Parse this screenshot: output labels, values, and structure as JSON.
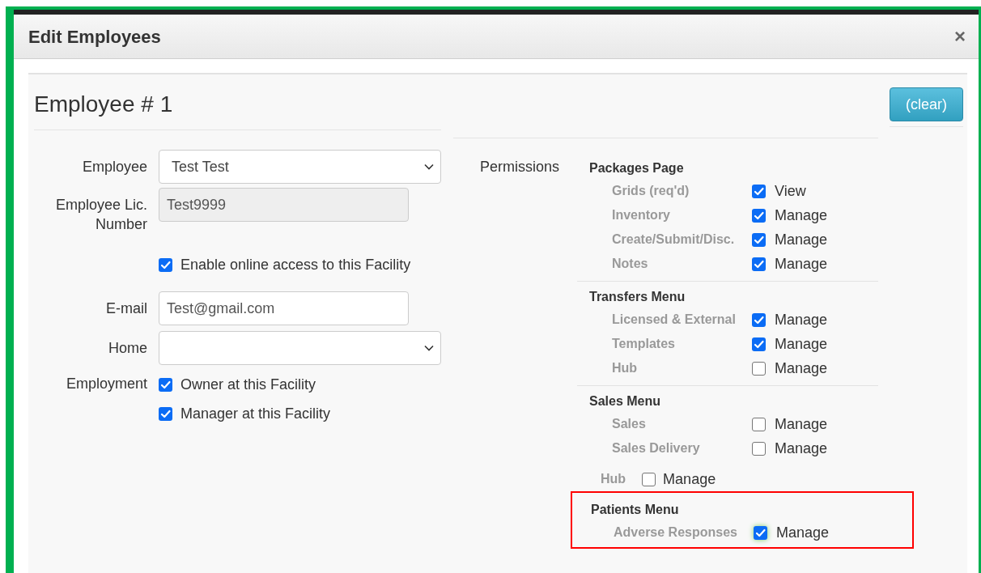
{
  "dialog": {
    "title": "Edit Employees",
    "close": "×"
  },
  "heading": "Employee # 1",
  "clear_button": "(clear)",
  "fields": [
    {
      "kind": "select",
      "label": "Employee",
      "value": "Test Test"
    },
    {
      "kind": "readonly",
      "label": "Employee Lic. Number",
      "value": "Test9999"
    },
    {
      "kind": "checkbox",
      "option": "Enable online access to this Facility",
      "checked": true
    },
    {
      "kind": "input",
      "label": "E-mail",
      "value": "Test@gmail.com"
    },
    {
      "kind": "select",
      "label": "Home"
    },
    {
      "kind": "checkbox",
      "label": "Employment",
      "option": "Owner at this Facility",
      "checked": true
    },
    {
      "kind": "checkbox",
      "option": "Manager at this Facility",
      "checked": true
    }
  ],
  "permissions": {
    "label": "Permissions",
    "sections": [
      {
        "kind": "group",
        "title": "Packages Page",
        "highlighted": false,
        "items": [
          {
            "label": "Grids (req'd)",
            "option": "View",
            "checked": true
          },
          {
            "label": "Inventory",
            "option": "Manage",
            "checked": true
          },
          {
            "label": "Create/Submit/Disc.",
            "option": "Manage",
            "checked": true
          },
          {
            "label": "Notes",
            "option": "Manage",
            "checked": true
          }
        ]
      },
      {
        "kind": "group",
        "title": "Transfers Menu",
        "highlighted": false,
        "items": [
          {
            "label": "Licensed & External",
            "option": "Manage",
            "checked": true
          },
          {
            "label": "Templates",
            "option": "Manage",
            "checked": true
          },
          {
            "label": "Hub",
            "option": "Manage",
            "checked": false
          }
        ]
      },
      {
        "kind": "group",
        "title": "Sales Menu",
        "highlighted": false,
        "items": [
          {
            "label": "Sales",
            "option": "Manage",
            "checked": false
          },
          {
            "label": "Sales Delivery",
            "option": "Manage",
            "checked": false
          }
        ]
      },
      {
        "kind": "inline",
        "label": "Hub",
        "option": "Manage",
        "checked": false
      },
      {
        "kind": "group",
        "title": "Patients Menu",
        "highlighted": true,
        "items": [
          {
            "label": "Adverse Responses",
            "option": "Manage",
            "checked": true
          }
        ]
      }
    ]
  }
}
